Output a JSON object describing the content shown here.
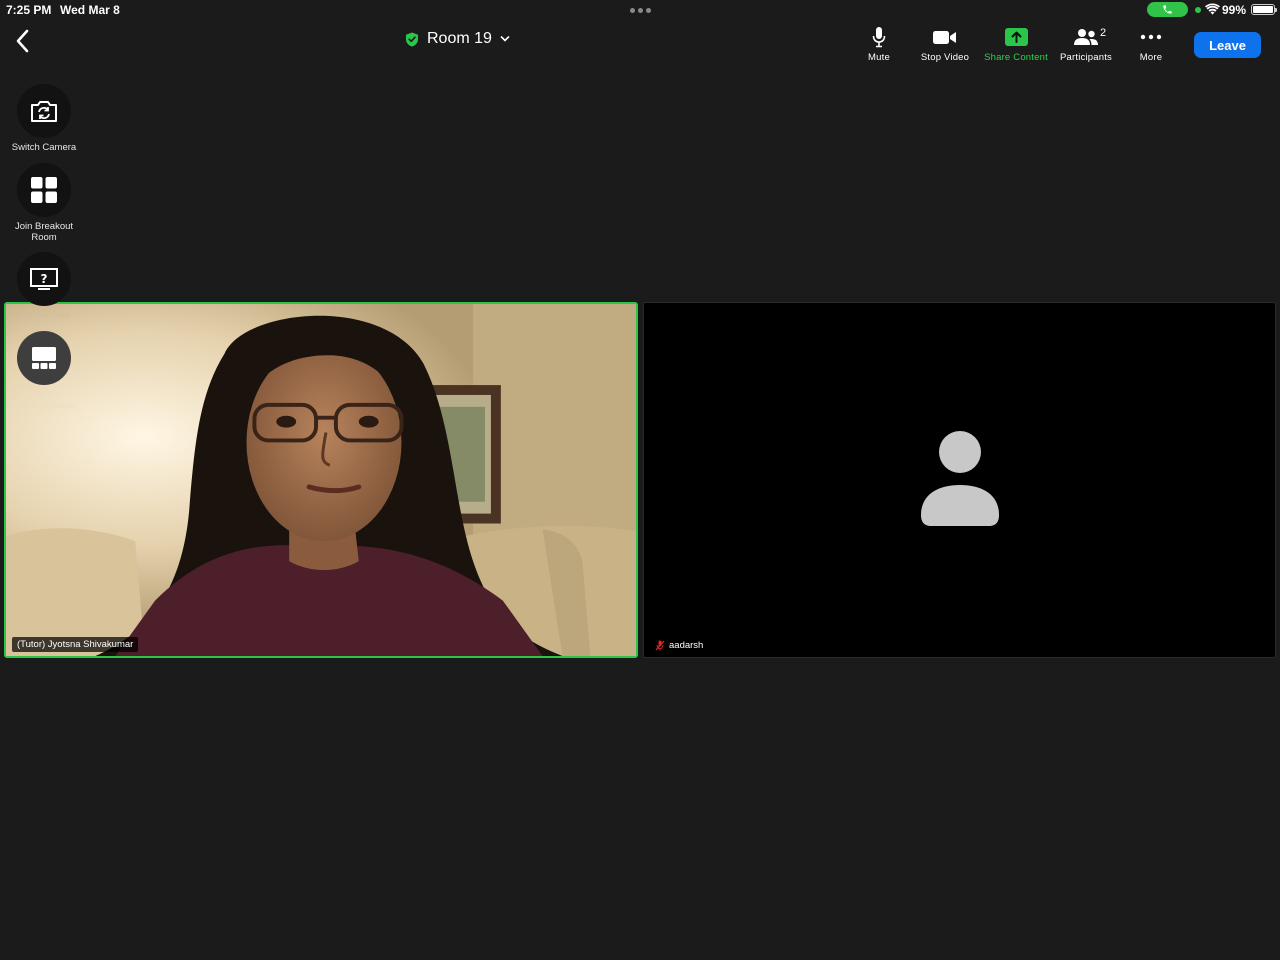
{
  "status_bar": {
    "time": "7:25 PM",
    "date": "Wed Mar 8",
    "battery": "99%"
  },
  "header": {
    "room_title": "Room 19"
  },
  "toolbar": {
    "mute_label": "Mute",
    "stop_video_label": "Stop Video",
    "share_content_label": "Share Content",
    "participants_label": "Participants",
    "participants_count": "2",
    "more_label": "More",
    "leave_label": "Leave"
  },
  "side_actions": {
    "switch_camera": "Switch Camera",
    "join_breakout_line1": "Join Breakout",
    "join_breakout_line2": "Room",
    "ask_for_help": "Ask For Help",
    "switch_speaker_line1": "Switch to",
    "switch_speaker_line2": "Active Speaker"
  },
  "tiles": {
    "tutor_name": "(Tutor) Jyotsna Shivakumar",
    "student_name": "aadarsh"
  },
  "colors": {
    "accent_green": "#2ac64a",
    "leave_blue": "#0e72ed",
    "muted_red": "#e02828",
    "background": "#1b1b1b"
  },
  "icons": {
    "back": "chevron-left-icon",
    "room_status": "shield-check-icon",
    "mute": "microphone-icon",
    "video": "video-camera-icon",
    "share": "share-upload-icon",
    "participants": "people-icon",
    "more": "ellipsis-icon",
    "switch_camera": "camera-rotate-icon",
    "breakout": "grid-icon",
    "ask_help": "question-icon",
    "speaker_view": "speaker-layout-icon",
    "avatar": "person-avatar-icon",
    "muted_mic": "muted-mic-icon"
  }
}
